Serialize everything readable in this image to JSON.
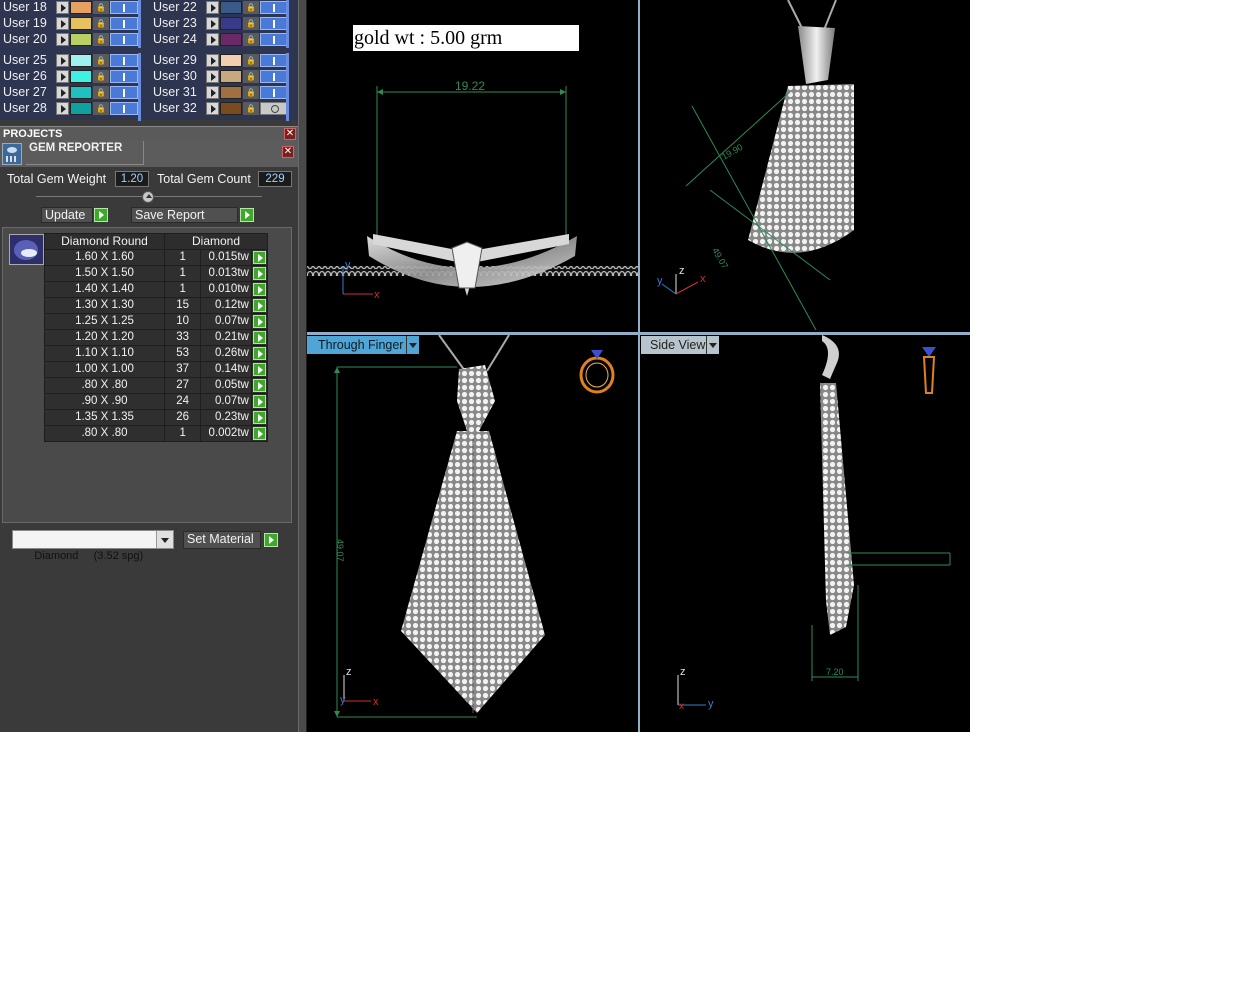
{
  "layers": {
    "rows": [
      {
        "left": "User 18",
        "left_color": "#e8a060",
        "right": "User 22",
        "right_color": "#3a5a8a"
      },
      {
        "left": "User 19",
        "left_color": "#e8c060",
        "right": "User 23",
        "right_color": "#3a3a8a"
      },
      {
        "left": "User 20",
        "left_color": "#b8d060",
        "right": "User 24",
        "right_color": "#6a2a6a"
      },
      {
        "left": "User 25",
        "left_color": "#a0f0f0",
        "right": "User 29",
        "right_color": "#f0d0b0"
      },
      {
        "left": "User 26",
        "left_color": "#40f0e0",
        "right": "User 30",
        "right_color": "#c8a880"
      },
      {
        "left": "User 27",
        "left_color": "#20c0c0",
        "right": "User 31",
        "right_color": "#a07040"
      },
      {
        "left": "User 28",
        "left_color": "#10a0a0",
        "right": "User 32",
        "right_color": "#7a4a20"
      }
    ]
  },
  "projects": {
    "title": "PROJECTS"
  },
  "gem_reporter": {
    "title": "GEM REPORTER",
    "total_weight_label": "Total Gem Weight",
    "total_weight": "1.20",
    "total_count_label": "Total Gem Count",
    "total_count": "229",
    "update_label": "Update",
    "save_label": "Save Report",
    "col_shape": "Diamond Round",
    "col_material": "Diamond",
    "rows": [
      {
        "size": "1.60 X 1.60",
        "count": "1",
        "weight": "0.015tw"
      },
      {
        "size": "1.50 X 1.50",
        "count": "1",
        "weight": "0.013tw"
      },
      {
        "size": "1.40 X 1.40",
        "count": "1",
        "weight": "0.010tw"
      },
      {
        "size": "1.30 X 1.30",
        "count": "15",
        "weight": "0.12tw"
      },
      {
        "size": "1.25 X 1.25",
        "count": "10",
        "weight": "0.07tw"
      },
      {
        "size": "1.20 X 1.20",
        "count": "33",
        "weight": "0.21tw"
      },
      {
        "size": "1.10 X 1.10",
        "count": "53",
        "weight": "0.26tw"
      },
      {
        "size": "1.00 X 1.00",
        "count": "37",
        "weight": "0.14tw"
      },
      {
        "size": ".80 X .80",
        "count": "27",
        "weight": "0.05tw"
      },
      {
        "size": ".90 X .90",
        "count": "24",
        "weight": "0.07tw"
      },
      {
        "size": "1.35 X 1.35",
        "count": "26",
        "weight": "0.23tw"
      },
      {
        "size": ".80 X .80",
        "count": "1",
        "weight": "0.002tw"
      }
    ],
    "material_select": "Diamond     (3.52 spg)",
    "set_material_label": "Set Material"
  },
  "viewports": {
    "gold_label": "gold wt : 5.00 grm",
    "top_dim": "19.22",
    "persp_dim1": "19.90",
    "persp_dim2": "49.07",
    "front_view_label": "Through Finger",
    "front_dim": "49.07",
    "side_view_label": "Side View",
    "side_dim": "7.20",
    "axis_x": "x",
    "axis_y": "y",
    "axis_z": "z"
  },
  "colors": {
    "dimension": "#2e8b57",
    "axis_x": "#d03030",
    "axis_y": "#3a7ad0",
    "axis_z": "#e0e0e0",
    "accent_blue": "#4fa6d6",
    "go_green": "#3ea82a"
  },
  "icons": {
    "ring_icon": "ring-icon",
    "pendant_icon": "pendant-icon",
    "gem_icon": "gem-thumbnail-icon"
  }
}
